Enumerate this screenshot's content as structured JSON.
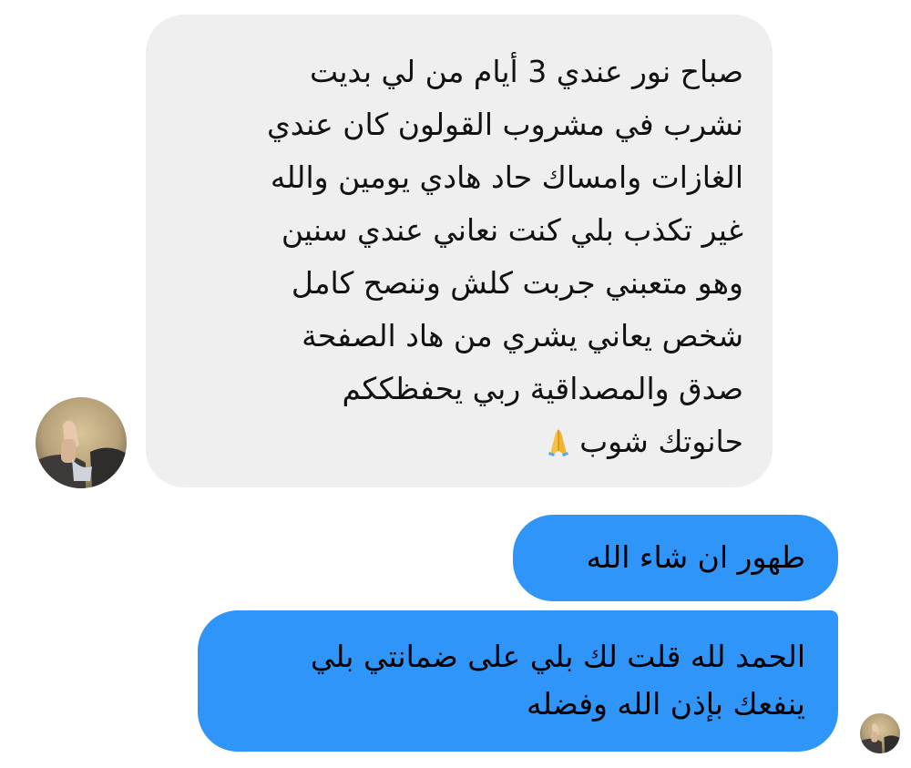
{
  "conversation": {
    "received_message": {
      "lines": [
        "صباح نور عندي 3 أيام من لي بديت",
        "نشرب في مشروب القولون كان عندي",
        "الغازات وامساك حاد هادي يومين والله",
        "غير تكذب بلي كنت نعاني عندي سنين",
        "وهو متعبني جربت كلش وننصح كامل",
        "شخص يعاني يشري من هاد الصفحة",
        "صدق والمصداقية ربي يحفظككم",
        "حانوتك شوب"
      ],
      "emoji": "🙏",
      "emoji_icon": "folded-hands-icon"
    },
    "sent_messages": [
      {
        "lines": [
          "طهور ان شاء الله"
        ]
      },
      {
        "lines": [
          "الحمد لله قلت لك بلي على ضمانتي بلي",
          "ينفعك بإذن الله وفضله"
        ]
      }
    ],
    "colors": {
      "received_bubble": "#efefef",
      "sent_bubble": "#2f95f8",
      "text": "#111111"
    }
  }
}
